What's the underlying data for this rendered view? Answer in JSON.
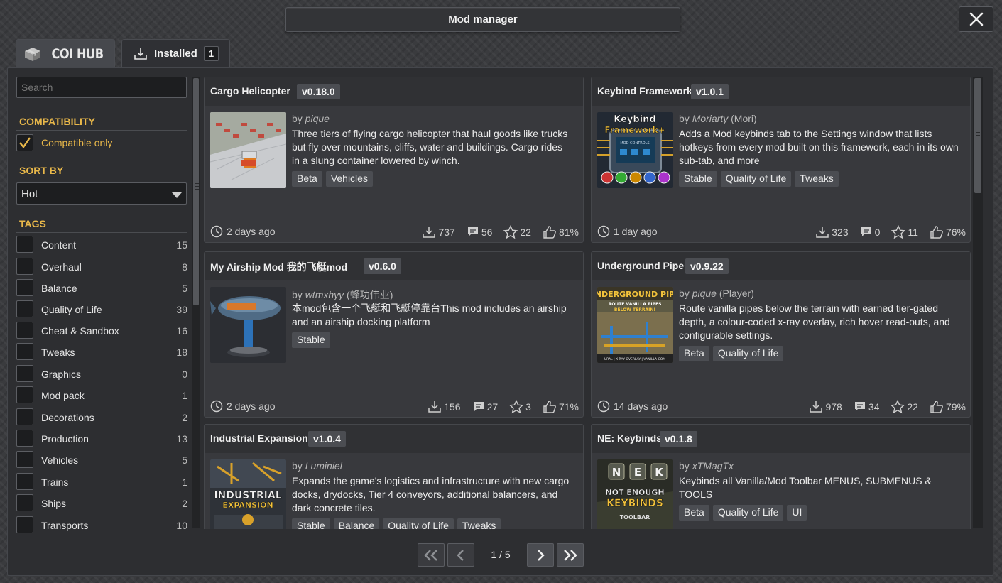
{
  "window": {
    "title": "Mod manager"
  },
  "tabs": [
    {
      "label": "COI HUB",
      "icon": "box-icon"
    },
    {
      "label": "Installed",
      "count": "1",
      "icon": "download-icon"
    }
  ],
  "sidebar": {
    "search_placeholder": "Search",
    "compatibility": {
      "header": "COMPATIBILITY",
      "label": "Compatible only",
      "checked": true
    },
    "sort": {
      "header": "SORT BY",
      "selected": "Hot"
    },
    "tags_header": "TAGS",
    "tags": [
      {
        "name": "Content",
        "count": "15"
      },
      {
        "name": "Overhaul",
        "count": "8"
      },
      {
        "name": "Balance",
        "count": "5"
      },
      {
        "name": "Quality of Life",
        "count": "39"
      },
      {
        "name": "Cheat & Sandbox",
        "count": "16"
      },
      {
        "name": "Tweaks",
        "count": "18"
      },
      {
        "name": "Graphics",
        "count": "0"
      },
      {
        "name": "Mod pack",
        "count": "1"
      },
      {
        "name": "Decorations",
        "count": "2"
      },
      {
        "name": "Production",
        "count": "13"
      },
      {
        "name": "Vehicles",
        "count": "5"
      },
      {
        "name": "Trains",
        "count": "1"
      },
      {
        "name": "Ships",
        "count": "2"
      },
      {
        "name": "Transports",
        "count": "10"
      }
    ]
  },
  "mods": [
    {
      "title": "Cargo Helicopter",
      "version": "v0.18.0",
      "by": "by ",
      "author": "pique",
      "author_extra": "",
      "description": "Three tiers of flying cargo helicopter that haul goods like trucks but fly over mountains, cliffs, water and buildings. Cargo rides in a slung container lowered by winch.",
      "tags": [
        "Beta",
        "Vehicles"
      ],
      "time": "2 days ago",
      "downloads": "737",
      "comments": "56",
      "stars": "22",
      "likes": "81%",
      "thumb": "cargo-helicopter"
    },
    {
      "title": "Keybind Framework",
      "version": "v1.0.1",
      "by": "by ",
      "author": "Moriarty",
      "author_extra": " (Mori)",
      "description": "Adds a Mod keybinds tab to the Settings window that lists hotkeys from every mod built on this framework, each in its own sub-tab, and more",
      "tags": [
        "Stable",
        "Quality of Life",
        "Tweaks"
      ],
      "time": "1 day ago",
      "downloads": "323",
      "comments": "0",
      "stars": "11",
      "likes": "76%",
      "thumb": "keybind-framework",
      "thumb_text": [
        "Keybind",
        "Framework+",
        "MOD CONTROLS"
      ]
    },
    {
      "title": "My Airship Mod 我的飞艇mod",
      "version": "v0.6.0",
      "by": "by ",
      "author": "wtmxhyy",
      "author_extra": " (蜂功伟业)",
      "description": "本mod包含一个飞艇和飞艇停靠台This mod includes an airship and an airship docking platform",
      "tags": [
        "Stable"
      ],
      "time": "2 days ago",
      "downloads": "156",
      "comments": "27",
      "stars": "3",
      "likes": "71%",
      "thumb": "airship"
    },
    {
      "title": "Underground Pipes",
      "version": "v0.9.22",
      "by": "by ",
      "author": "pique",
      "author_extra": " (Player)",
      "description": "Route vanilla pipes below the terrain with earned tier-gated depth, a colour-coded x-ray overlay, rich hover read-outs, and configurable settings.",
      "tags": [
        "Beta",
        "Quality of Life"
      ],
      "time": "14 days ago",
      "downloads": "978",
      "comments": "34",
      "stars": "22",
      "likes": "79%",
      "thumb": "underground-pipes",
      "thumb_text": [
        "NDERGROUND PIP",
        "ROUTE VANILLA PIPES",
        "BELOW TERRAIN!",
        "URAL | X-RAY OVERLAY | VANILLA COM"
      ]
    },
    {
      "title": "Industrial Expansion",
      "version": "v1.0.4",
      "by": "by ",
      "author": "Luminiel",
      "author_extra": "",
      "description": "Expands the game's logistics and infrastructure with new cargo docks, drydocks, Tier 4 conveyors, additional balancers, and dark concrete tiles.",
      "tags": [
        "Stable",
        "Balance",
        "Quality of Life",
        "Tweaks"
      ],
      "time": "",
      "downloads": "",
      "comments": "",
      "stars": "",
      "likes": "",
      "thumb": "industrial-expansion",
      "thumb_text": [
        "INDUSTRIAL",
        "EXPANSION"
      ]
    },
    {
      "title": "NE: Keybinds",
      "version": "v0.1.8",
      "by": "by ",
      "author": "xTMagTx",
      "author_extra": "",
      "description": "Keybinds all Vanilla/Mod Toolbar MENUS, SUBMENUS & TOOLS",
      "tags": [
        "Beta",
        "Quality of Life",
        "UI"
      ],
      "time": "",
      "downloads": "",
      "comments": "",
      "stars": "",
      "likes": "",
      "thumb": "ne-keybinds",
      "thumb_text": [
        "N",
        "E",
        "K",
        "NOT ENOUGH",
        "KEYBINDS",
        "TOOLBAR"
      ]
    }
  ],
  "pagination": {
    "text": "1 / 5"
  },
  "colors": {
    "accent": "#e9b84a",
    "panel": "#2d2e31",
    "card": "#38393d"
  }
}
